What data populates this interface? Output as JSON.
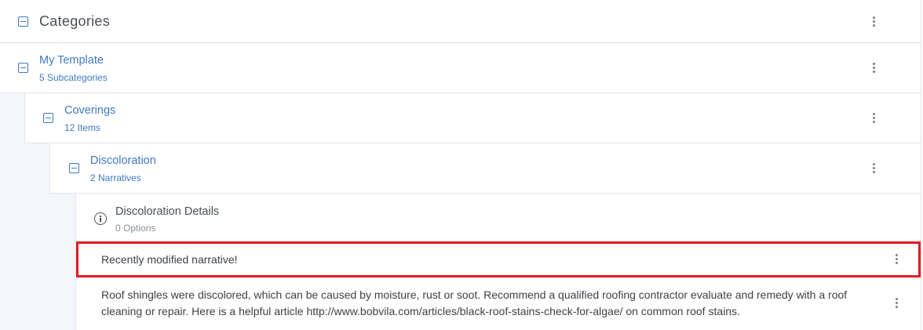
{
  "header": {
    "title": "Categories"
  },
  "tree": {
    "template": {
      "name": "My Template",
      "count": "5 Subcategories"
    },
    "subcategory": {
      "name": "Coverings",
      "count": "12 Items"
    },
    "item": {
      "name": "Discoloration",
      "count": "2 Narratives"
    },
    "details": {
      "name": "Discoloration Details",
      "count": "0 Options"
    },
    "narratives": [
      {
        "text": "Recently modified narrative!"
      },
      {
        "text": "Roof shingles were discolored, which can be caused by moisture, rust or soot. Recommend a qualified roofing contractor evaluate and remedy with a roof cleaning or repair. Here is a helpful article http://www.bobvila.com/articles/black-roof-stains-check-for-algae/ on common roof stains."
      }
    ]
  },
  "icons": {
    "toggle": "collapse-square-icon",
    "menu": "kebab-menu-icon",
    "info": "info-circle-icon"
  },
  "colors": {
    "link": "#3f78c3",
    "highlight_border": "#e01b24",
    "indent_background": "#f4f6f9",
    "divider": "#e3e6ea"
  }
}
